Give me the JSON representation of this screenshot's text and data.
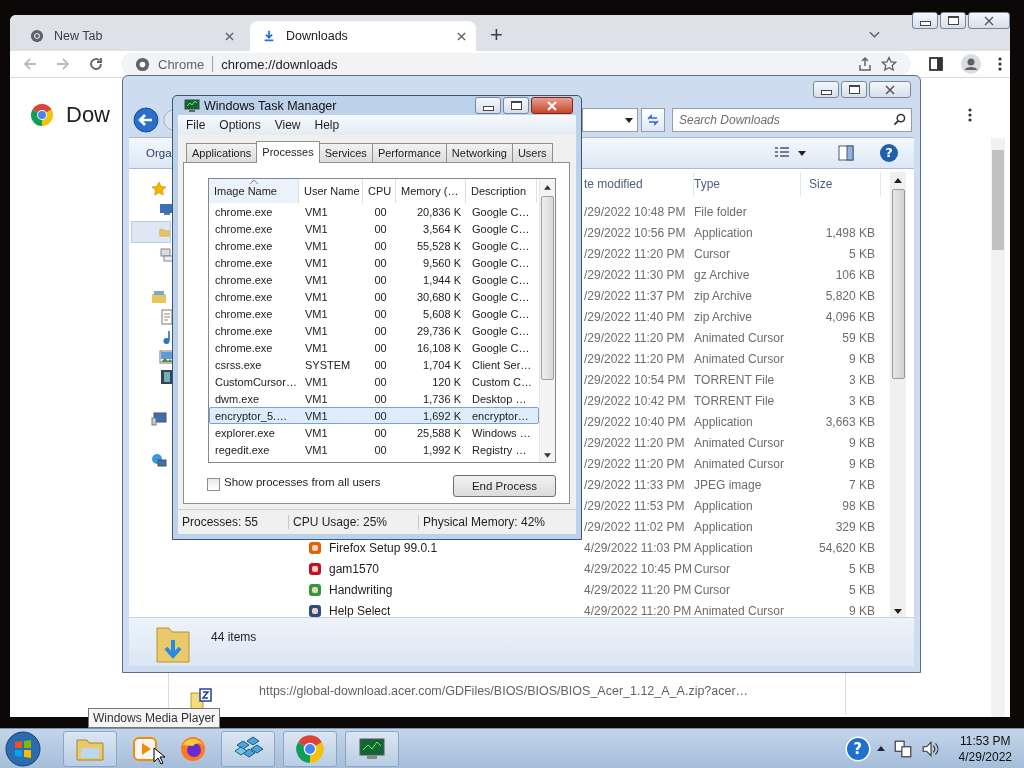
{
  "chrome": {
    "tabs": [
      {
        "title": "New Tab",
        "selected": false
      },
      {
        "title": "Downloads",
        "selected": true
      }
    ],
    "new_tab": "+",
    "omnibox": {
      "site": "Chrome",
      "url": "chrome://downloads"
    },
    "page_title": "Dow",
    "download": {
      "url": "https://global-download.acer.com/GDFiles/BIOS/BIOS/BIOS_Acer_1.12_A_A.zip?acer…"
    }
  },
  "explorer": {
    "search": {
      "placeholder": "Search Downloads"
    },
    "help": "?",
    "organize": "Orga",
    "columns": [
      "te modified",
      "Type",
      "Size"
    ],
    "rows": [
      {
        "date": "/29/2022 10:48 PM",
        "type": "File folder"
      },
      {
        "date": "/29/2022 10:56 PM",
        "type": "Application",
        "size": "1,498 KB"
      },
      {
        "date": "/29/2022 11:20 PM",
        "type": "Cursor",
        "size": "5 KB"
      },
      {
        "date": "/29/2022 11:30 PM",
        "type": "gz Archive",
        "size": "106 KB"
      },
      {
        "date": "/29/2022 11:37 PM",
        "type": "zip Archive",
        "size": "5,820 KB"
      },
      {
        "date": "/29/2022 11:40 PM",
        "type": "zip Archive",
        "size": "4,096 KB"
      },
      {
        "date": "/29/2022 11:20 PM",
        "type": "Animated Cursor",
        "size": "59 KB"
      },
      {
        "date": "/29/2022 11:20 PM",
        "type": "Animated Cursor",
        "size": "9 KB"
      },
      {
        "date": "/29/2022 10:54 PM",
        "type": "TORRENT File",
        "size": "3 KB"
      },
      {
        "date": "/29/2022 10:42 PM",
        "type": "TORRENT File",
        "size": "3 KB"
      },
      {
        "date": "/29/2022 10:40 PM",
        "type": "Application",
        "size": "3,663 KB"
      },
      {
        "date": "/29/2022 11:20 PM",
        "type": "Animated Cursor",
        "size": "9 KB"
      },
      {
        "date": "/29/2022 11:20 PM",
        "type": "Animated Cursor",
        "size": "9 KB"
      },
      {
        "date": "/29/2022 11:33 PM",
        "type": "JPEG image",
        "size": "7 KB"
      },
      {
        "date": "/29/2022 11:53 PM",
        "type": "Application",
        "size": "98 KB"
      },
      {
        "date": "/29/2022 11:02 PM",
        "type": "Application",
        "size": "329 KB"
      },
      {
        "name": "Firefox Setup 99.0.1",
        "date": "4/29/2022 11:03 PM",
        "type": "Application",
        "size": "54,620 KB"
      },
      {
        "name": "gam1570",
        "date": "4/29/2022 10:45 PM",
        "type": "Cursor",
        "size": "5 KB"
      },
      {
        "name": "Handwriting",
        "date": "4/29/2022 11:20 PM",
        "type": "Cursor",
        "size": "5 KB"
      },
      {
        "name": "Help Select",
        "date": "4/29/2022 11:20 PM",
        "type": "Animated Cursor",
        "size": "9 KB"
      }
    ],
    "status": "44 items"
  },
  "task_manager": {
    "title": "Windows Task Manager",
    "menu": [
      "File",
      "Options",
      "View",
      "Help"
    ],
    "tabs": [
      {
        "label": "Applications",
        "selected": false
      },
      {
        "label": "Processes",
        "selected": true
      },
      {
        "label": "Services",
        "selected": false
      },
      {
        "label": "Performance",
        "selected": false
      },
      {
        "label": "Networking",
        "selected": false
      },
      {
        "label": "Users",
        "selected": false
      }
    ],
    "columns": [
      "Image Name",
      "User Name",
      "CPU",
      "Memory (…",
      "Description"
    ],
    "processes": [
      {
        "image": "chrome.exe",
        "user": "VM1",
        "cpu": "00",
        "memory": "20,836 K",
        "description": "Google C…",
        "selected": false
      },
      {
        "image": "chrome.exe",
        "user": "VM1",
        "cpu": "00",
        "memory": "3,564 K",
        "description": "Google C…",
        "selected": false
      },
      {
        "image": "chrome.exe",
        "user": "VM1",
        "cpu": "00",
        "memory": "55,528 K",
        "description": "Google C…",
        "selected": false
      },
      {
        "image": "chrome.exe",
        "user": "VM1",
        "cpu": "00",
        "memory": "9,560 K",
        "description": "Google C…",
        "selected": false
      },
      {
        "image": "chrome.exe",
        "user": "VM1",
        "cpu": "00",
        "memory": "1,944 K",
        "description": "Google C…",
        "selected": false
      },
      {
        "image": "chrome.exe",
        "user": "VM1",
        "cpu": "00",
        "memory": "30,680 K",
        "description": "Google C…",
        "selected": false
      },
      {
        "image": "chrome.exe",
        "user": "VM1",
        "cpu": "00",
        "memory": "5,608 K",
        "description": "Google C…",
        "selected": false
      },
      {
        "image": "chrome.exe",
        "user": "VM1",
        "cpu": "00",
        "memory": "29,736 K",
        "description": "Google C…",
        "selected": false
      },
      {
        "image": "chrome.exe",
        "user": "VM1",
        "cpu": "00",
        "memory": "16,108 K",
        "description": "Google C…",
        "selected": false
      },
      {
        "image": "csrss.exe",
        "user": "SYSTEM",
        "cpu": "00",
        "memory": "1,704 K",
        "description": "Client Ser…",
        "selected": false
      },
      {
        "image": "CustomCursor…",
        "user": "VM1",
        "cpu": "00",
        "memory": "120 K",
        "description": "Custom C…",
        "selected": false
      },
      {
        "image": "dwm.exe",
        "user": "VM1",
        "cpu": "00",
        "memory": "1,736 K",
        "description": "Desktop …",
        "selected": false
      },
      {
        "image": "encryptor_5.…",
        "user": "VM1",
        "cpu": "00",
        "memory": "1,692 K",
        "description": "encryptor…",
        "selected": true
      },
      {
        "image": "explorer.exe",
        "user": "VM1",
        "cpu": "00",
        "memory": "25,588 K",
        "description": "Windows …",
        "selected": false
      },
      {
        "image": "regedit.exe",
        "user": "VM1",
        "cpu": "00",
        "memory": "1,992 K",
        "description": "Registry …",
        "selected": false
      }
    ],
    "show_all": {
      "label": "Show processes from all users",
      "checked": false
    },
    "end_button": "End Process",
    "status": [
      "Processes: 55",
      "CPU Usage: 25%",
      "Physical Memory: 42%"
    ]
  },
  "taskbar": {
    "tooltip": "Windows Media Player",
    "help": "?",
    "clock": {
      "time": "11:53 PM",
      "date": "4/29/2022"
    }
  }
}
